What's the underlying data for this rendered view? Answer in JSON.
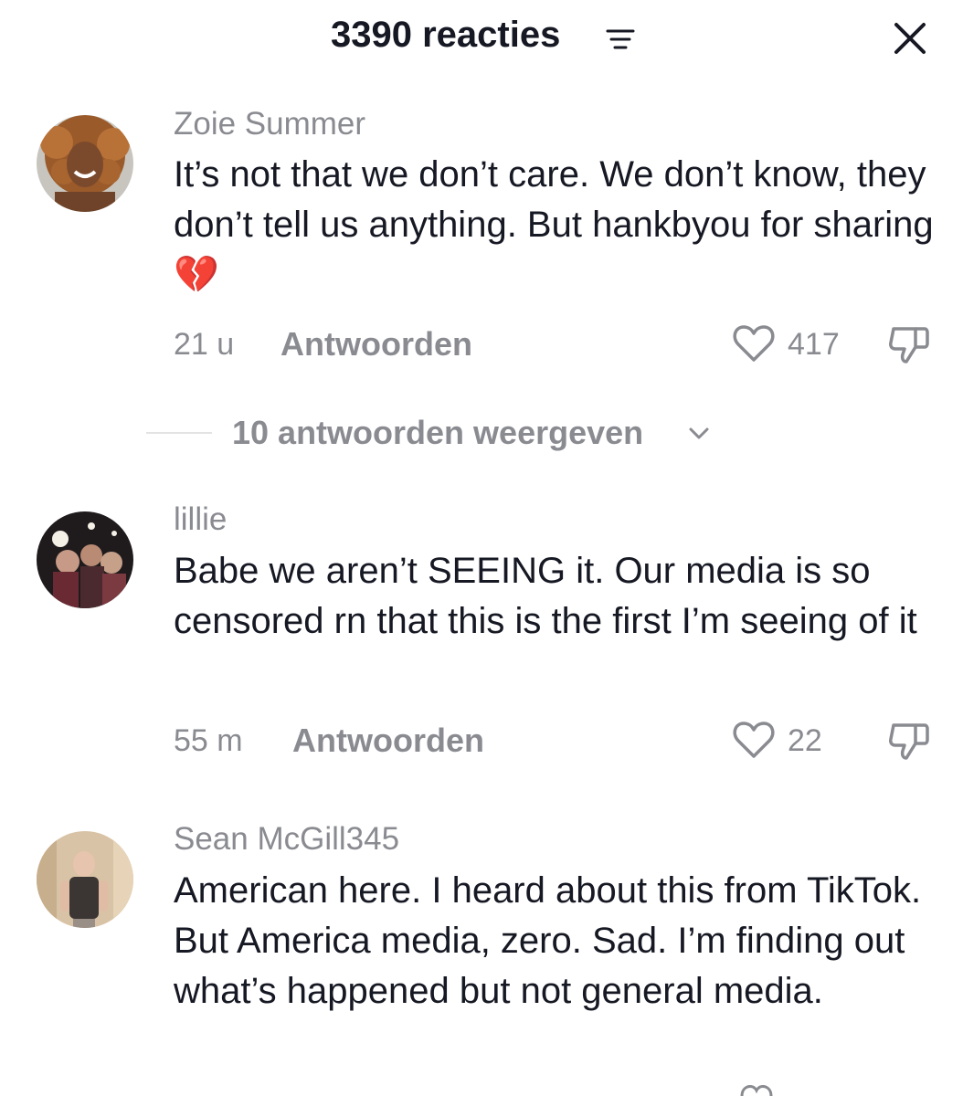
{
  "header": {
    "title": "3390 reacties",
    "filter_icon": "filter-sort-icon",
    "close_icon": "close-icon"
  },
  "comments": [
    {
      "username": "Zoie Summer",
      "text": "It’s not that we don’t care. We don’t know, they don’t tell us anything. But hankbyou for sharing 💔",
      "time": "21 u",
      "reply_label": "Antwoorden",
      "likes": "417",
      "avatar": "avatar-woman-curly-hair"
    },
    {
      "username": "lillie",
      "text": "Babe we aren’t SEEING it. Our media is so censored rn that this is the first I’m seeing of it",
      "time": "55 m",
      "reply_label": "Antwoorden",
      "likes": "22",
      "avatar": "avatar-group-photo"
    },
    {
      "username": "Sean McGill345",
      "text": "American here. I heard about this from TikTok. But America media, zero. Sad. I’m finding out what’s happened but not general media.",
      "avatar": "avatar-man-mirror-selfie"
    }
  ],
  "replies_toggle": {
    "label": "10 antwoorden weergeven",
    "icon": "chevron-down-icon"
  },
  "colors": {
    "text_primary": "#161823",
    "text_secondary": "#8a8b91",
    "divider": "#e3e3e4",
    "broken_heart": "#f06a8c"
  }
}
